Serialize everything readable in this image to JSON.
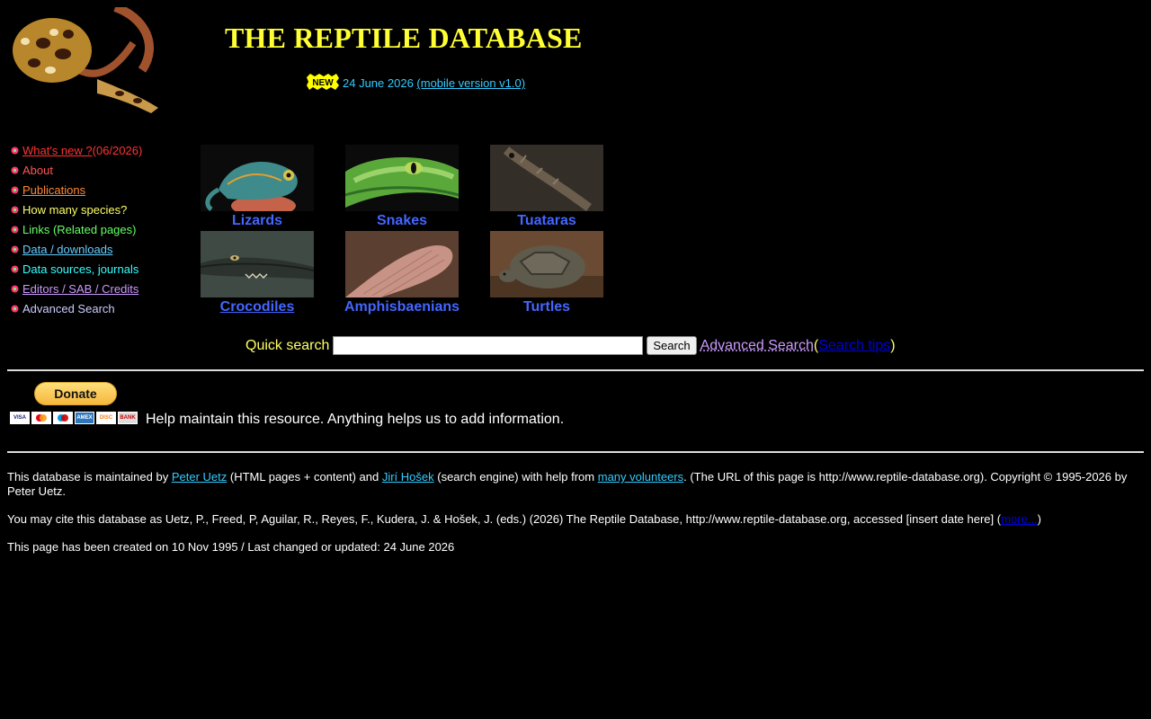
{
  "header": {
    "title": "THE REPTILE DATABASE",
    "new_badge": "NEW",
    "update_date": "24 June 2026",
    "mobile_version": "(mobile version v1.0)"
  },
  "sidebar": {
    "items": [
      {
        "label": "What's new ?",
        "suffix": " (06/2026)",
        "color": "#ff3333"
      },
      {
        "label": "About",
        "color": "#ff5555"
      },
      {
        "label": "Publications",
        "color": "#ff8833"
      },
      {
        "label": "How many species?",
        "color": "#ffff66"
      },
      {
        "label": "Links (Related pages)",
        "color": "#66ff66"
      },
      {
        "label": "Data / downloads",
        "color": "#66ccff"
      },
      {
        "label": "Data sources, journals",
        "color": "#33ffff"
      },
      {
        "label": "Editors / SAB / Credits",
        "color": "#cc99ff"
      },
      {
        "label": "Advanced Search",
        "color": "#ccccff"
      }
    ]
  },
  "taxa": [
    {
      "name": "Lizards"
    },
    {
      "name": "Snakes"
    },
    {
      "name": "Tuataras"
    },
    {
      "name": "Crocodiles"
    },
    {
      "name": "Amphisbaenians"
    },
    {
      "name": "Turtles"
    }
  ],
  "search": {
    "label": "Quick search",
    "input_value": "",
    "button": "Search",
    "advanced": "Advanced Search",
    "open_paren": " ( ",
    "tips": "Search tips",
    "close_paren": ")"
  },
  "donate": {
    "button": "Donate",
    "cards": [
      "VISA",
      "MC",
      "MAE",
      "AMEX",
      "DISC",
      "BANK"
    ],
    "message": "Help maintain this resource. Anything helps us to add information."
  },
  "footer": {
    "p1_a": "This database is maintained by ",
    "p1_link1": "Peter Uetz",
    "p1_b": " (HTML pages + content) and ",
    "p1_link2": "Jirí Hošek",
    "p1_c": " (search engine) with help from ",
    "p1_link3": "many volunteers",
    "p1_d": ". (The URL of this page is http://www.reptile-database.org). Copyright © 1995-2026 by Peter Uetz.",
    "p2_a": "You may cite this database as Uetz, P., Freed, P, Aguilar, R., Reyes, F., Kudera, J. & Hošek, J. (eds.) (2026) The Reptile Database, http://www.reptile-database.org, accessed [insert date here] (",
    "p2_link": "more...",
    "p2_b": ")",
    "p3": "This page has been created on 10 Nov 1995 / Last changed or updated: 24 June 2026"
  },
  "colors": {
    "title": "#ffff33",
    "taxon_link": "#4466ff",
    "footer_link": "#33ccff"
  }
}
